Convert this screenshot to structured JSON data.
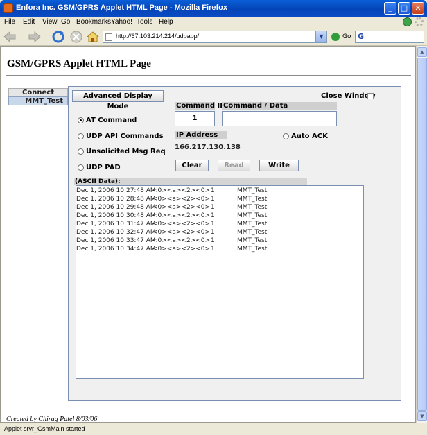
{
  "window": {
    "title": "Enfora Inc. GSM/GPRS Applet HTML Page - Mozilla Firefox",
    "minimize_glyph": "_",
    "maximize_glyph": "□",
    "close_glyph": "✕"
  },
  "menubar": {
    "items": [
      {
        "label": "File"
      },
      {
        "label": "Edit"
      },
      {
        "label": "View"
      },
      {
        "label": "Go"
      },
      {
        "label": "Bookmarks"
      },
      {
        "label": "Yahoo!"
      },
      {
        "label": "Tools"
      },
      {
        "label": "Help"
      }
    ]
  },
  "navbar": {
    "url": "http://67.103.214.214/udpapp/",
    "go_label": "Go",
    "search_glyph": "G"
  },
  "page": {
    "title": "GSM/GPRS Applet HTML Page",
    "footer": "Created by Chirag Patel 8/03/06"
  },
  "applet": {
    "tabs": {
      "connect": "Connect",
      "device": "MMT_Test"
    },
    "advanced_display_button": "Advanced Display Mode",
    "close_window_label": "Close Window",
    "command_id_label": "Command ID",
    "command_data_label": "Command / Data",
    "command_id_value": "1",
    "command_data_value": "",
    "ip_address_label": "IP Address",
    "ip_address_value": "166.217.130.138",
    "auto_ack_label": "Auto ACK",
    "radios": [
      {
        "label": "AT Command",
        "checked": true
      },
      {
        "label": "UDP API Commands",
        "checked": false
      },
      {
        "label": "Unsolicited Msg Req",
        "checked": false
      },
      {
        "label": "UDP PAD",
        "checked": false
      }
    ],
    "buttons": {
      "clear": "Clear",
      "read": "Read",
      "write": "Write"
    },
    "ascii_header": "(ASCII Data):",
    "log": [
      {
        "time": "Dec 1, 2006 10:27:48 AM:",
        "data": "<0><a><2><0>",
        "id": "1",
        "name": "MMT_Test"
      },
      {
        "time": "Dec 1, 2006 10:28:48 AM:",
        "data": "<0><a><2><0>",
        "id": "1",
        "name": "MMT_Test"
      },
      {
        "time": "Dec 1, 2006 10:29:48 AM:",
        "data": "<0><a><2><0>",
        "id": "1",
        "name": "MMT_Test"
      },
      {
        "time": "Dec 1, 2006 10:30:48 AM:",
        "data": "<0><a><2><0>",
        "id": "1",
        "name": "MMT_Test"
      },
      {
        "time": "Dec 1, 2006 10:31:47 AM:",
        "data": "<0><a><2><0>",
        "id": "1",
        "name": "MMT_Test"
      },
      {
        "time": "Dec 1, 2006 10:32:47 AM:",
        "data": "<0><a><2><0>",
        "id": "1",
        "name": "MMT_Test"
      },
      {
        "time": "Dec 1, 2006 10:33:47 AM:",
        "data": "<0><a><2><0>",
        "id": "1",
        "name": "MMT_Test"
      },
      {
        "time": "Dec 1, 2006 10:34:47 AM:",
        "data": "<0><a><2><0>",
        "id": "1",
        "name": "MMT_Test"
      }
    ]
  },
  "statusbar": {
    "text": "Applet srvr_GsmMain started"
  },
  "colors": {
    "titlebar": "#0544b8",
    "panel_border": "#7a8fb1",
    "tab_active": "#c9d7ea"
  }
}
